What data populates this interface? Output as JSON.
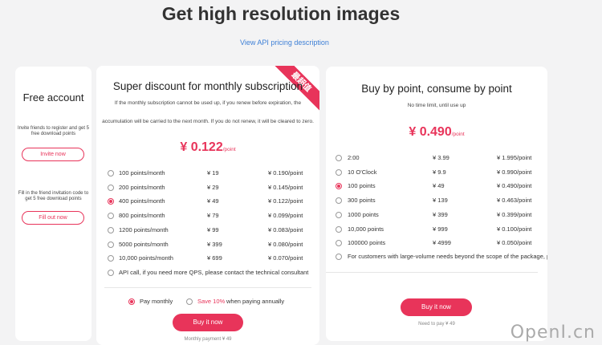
{
  "header": {
    "title": "Get high resolution images",
    "api_link": "View API pricing description"
  },
  "free": {
    "title": "Free account",
    "invite_desc": "Invite friends to register and get 5 free download points",
    "invite_button": "Invite now",
    "fill_desc": "Fill in the friend invitation code to get 5 free download points",
    "fill_button": "Fill out now"
  },
  "monthly": {
    "ribbon": "最超值",
    "title": "Super discount for monthly subscription",
    "desc_line1": "If the monthly subscription cannot be used up, if you renew before expiration, the",
    "desc_line2": "accumulation will be carried to the next month. If you do not renew, it will be cleared to zero.",
    "price": "¥ 0.122",
    "price_unit": "/point",
    "plans": [
      {
        "points": "100 points/month",
        "price": "¥ 19",
        "unit_price": "¥ 0.190/point",
        "selected": false
      },
      {
        "points": "200 points/month",
        "price": "¥ 29",
        "unit_price": "¥ 0.145/point",
        "selected": false
      },
      {
        "points": "400 points/month",
        "price": "¥ 49",
        "unit_price": "¥ 0.122/point",
        "selected": true
      },
      {
        "points": "800 points/month",
        "price": "¥ 79",
        "unit_price": "¥ 0.099/point",
        "selected": false
      },
      {
        "points": "1200 points/month",
        "price": "¥ 99",
        "unit_price": "¥ 0.083/point",
        "selected": false
      },
      {
        "points": "5000 points/month",
        "price": "¥ 399",
        "unit_price": "¥ 0.080/point",
        "selected": false
      },
      {
        "points": "10,000 points/month",
        "price": "¥ 699",
        "unit_price": "¥ 0.070/point",
        "selected": false
      }
    ],
    "api_call": "API call, if you need more QPS, please contact the technical consultant",
    "pay_monthly": "Pay monthly",
    "save_label": "Save 10%",
    "save_suffix": "when paying annually",
    "buy_button": "Buy it now",
    "footer": "Monthly payment ¥ 49"
  },
  "point": {
    "title": "Buy by point, consume by point",
    "subtitle": "No time limit, until use up",
    "price": "¥ 0.490",
    "price_unit": "/point",
    "plans": [
      {
        "points": "2:00",
        "price": "¥ 3.99",
        "unit_price": "¥ 1.995/point",
        "selected": false
      },
      {
        "points": "10 O'Clock",
        "price": "¥ 9.9",
        "unit_price": "¥ 0.990/point",
        "selected": false
      },
      {
        "points": "100 points",
        "price": "¥ 49",
        "unit_price": "¥ 0.490/point",
        "selected": true
      },
      {
        "points": "300 points",
        "price": "¥ 139",
        "unit_price": "¥ 0.463/point",
        "selected": false
      },
      {
        "points": "1000 points",
        "price": "¥ 399",
        "unit_price": "¥ 0.399/point",
        "selected": false
      },
      {
        "points": "10,000 points",
        "price": "¥ 999",
        "unit_price": "¥ 0.100/point",
        "selected": false
      },
      {
        "points": "100000 points",
        "price": "¥ 4999",
        "unit_price": "¥ 0.050/point",
        "selected": false
      }
    ],
    "large_volume": "For customers with large-volume needs beyond the scope of the package, please contact us",
    "buy_button": "Buy it now",
    "footer": "Need to pay ¥ 49"
  },
  "watermark": "OpenI.cn",
  "colors": {
    "accent": "#e8345a",
    "link": "#3d7fd6",
    "background": "#f3f3f4"
  }
}
